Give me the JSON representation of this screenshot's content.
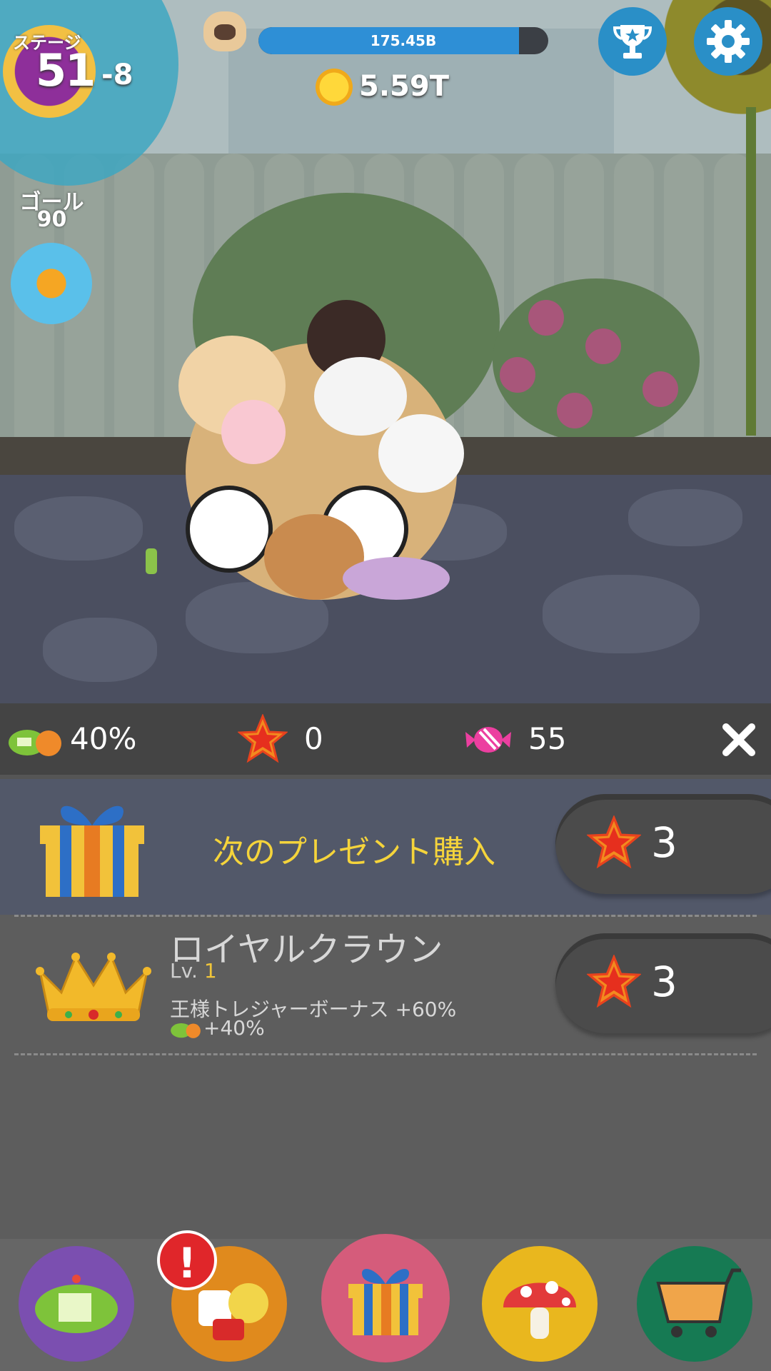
{
  "hud": {
    "stage_label": "ステージ",
    "stage_number": "51",
    "stage_sub": "-8",
    "goal_label": "ゴール",
    "goal_value": "90",
    "progress_text": "175.45B",
    "progress_fraction": 0.9,
    "coins": "5.59T"
  },
  "stats": {
    "cousin_percent": "40%",
    "stars": "0",
    "candy": "55"
  },
  "present": {
    "title": "次のプレゼント購入",
    "cost": "3"
  },
  "item": {
    "name": "ロイヤルクラウン",
    "level_prefix": "Lv.",
    "level_value": "1",
    "bonus_text": "王様トレジャーボーナス +60%",
    "bonus_text2": "+40%",
    "cost": "3"
  },
  "colors": {
    "accent_yellow": "#f5d43b",
    "progress_blue": "#2e8fd6",
    "nav_purple": "#7b4fb0",
    "nav_orange": "#e08a1d",
    "nav_pink": "#d55c7b",
    "nav_yellow": "#e9b71e",
    "nav_green": "#167a53"
  },
  "icons": [
    "trophy-icon",
    "gear-icon",
    "star-icon",
    "candy-icon",
    "close-icon",
    "gift-icon",
    "crown-icon",
    "mushroom-icon",
    "cart-icon",
    "pug-icon",
    "coin-icon"
  ]
}
